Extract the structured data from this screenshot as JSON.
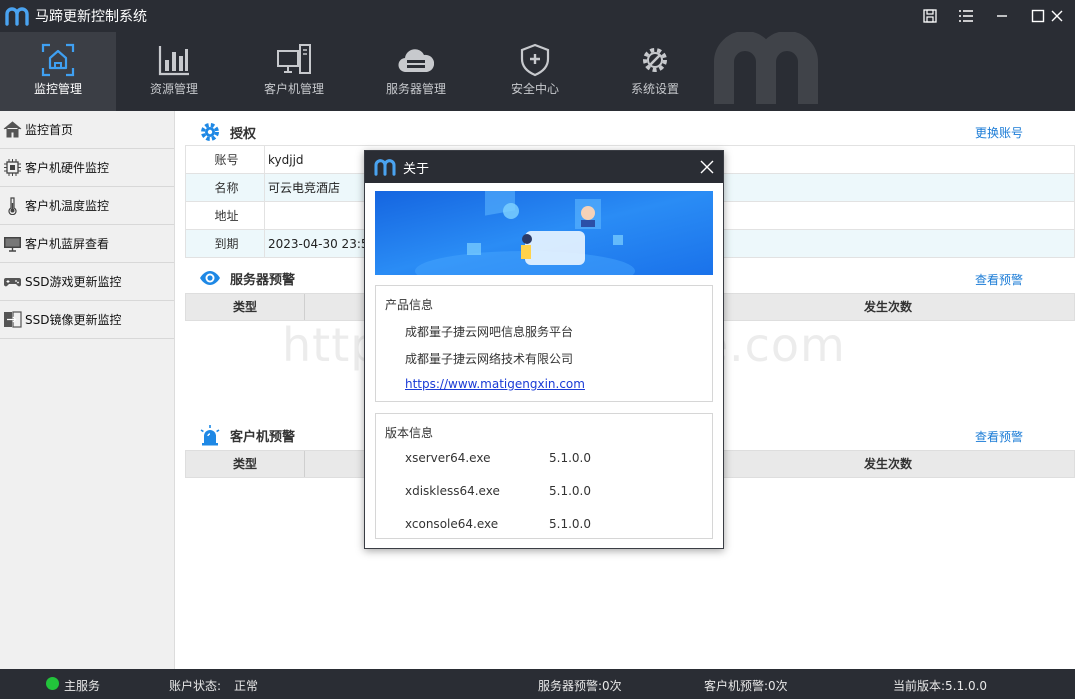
{
  "app": {
    "title": "马蹄更新控制系统"
  },
  "nav": [
    {
      "label": "监控管理",
      "icon": "monitor-home-icon",
      "active": true
    },
    {
      "label": "资源管理",
      "icon": "bar-chart-icon"
    },
    {
      "label": "客户机管理",
      "icon": "client-computers-icon"
    },
    {
      "label": "服务器管理",
      "icon": "cloud-server-icon"
    },
    {
      "label": "安全中心",
      "icon": "shield-icon"
    },
    {
      "label": "系统设置",
      "icon": "gear-wrench-icon"
    }
  ],
  "sidebar": [
    {
      "label": "监控首页",
      "icon": "home-icon"
    },
    {
      "label": "客户机硬件监控",
      "icon": "chip-icon"
    },
    {
      "label": "客户机温度监控",
      "icon": "thermometer-icon"
    },
    {
      "label": "客户机蓝屏查看",
      "icon": "monitor-icon"
    },
    {
      "label": "SSD游戏更新监控",
      "icon": "gamepad-icon"
    },
    {
      "label": "SSD镜像更新监控",
      "icon": "image-update-icon"
    }
  ],
  "auth": {
    "title": "授权",
    "switch_account": "更换账号",
    "rows": [
      {
        "key": "账号",
        "value": "kydjjd"
      },
      {
        "key": "名称",
        "value": "可云电竞酒店"
      },
      {
        "key": "地址",
        "value": ""
      },
      {
        "key": "到期",
        "value": "2023-04-30 23:59"
      }
    ]
  },
  "server_warn": {
    "title": "服务器预警",
    "link": "查看预警",
    "col_type": "类型",
    "col_count": "发生次数"
  },
  "client_warn": {
    "title": "客户机预警",
    "link": "查看预警",
    "col_type": "类型",
    "col_count": "发生次数"
  },
  "status": {
    "main_service": "主服务",
    "account_state_label": "账户状态:",
    "account_state": "正常",
    "server_warn": "服务器预警:0次",
    "client_warn": "客户机预警:0次",
    "version": "当前版本:5.1.0.0"
  },
  "dialog": {
    "title": "关于",
    "product_title": "产品信息",
    "product_lines": [
      "成都量子捷云网吧信息服务平台",
      "成都量子捷云网络技术有限公司"
    ],
    "url": "https://www.matigengxin.com",
    "version_title": "版本信息",
    "versions": [
      {
        "name": "xserver64.exe",
        "ver": "5.1.0.0"
      },
      {
        "name": "xdiskless64.exe",
        "ver": "5.1.0.0"
      },
      {
        "name": "xconsole64.exe",
        "ver": "5.1.0.0"
      }
    ]
  },
  "watermark": "https://www.58pxe.com",
  "colors": {
    "dark": "#2a2d34",
    "accent": "#1a7bd6",
    "icon_blue": "#1e88e5",
    "ok_green": "#22c33b"
  }
}
